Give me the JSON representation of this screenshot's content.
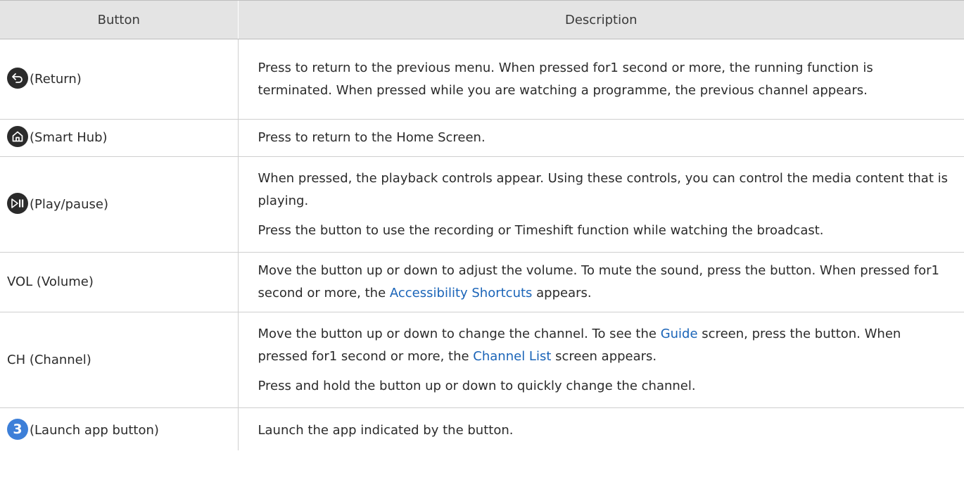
{
  "header": {
    "button": "Button",
    "description": "Description"
  },
  "rows": [
    {
      "icon": "return-icon",
      "label": "(Return)",
      "desc": [
        "Press to return to the previous menu. When pressed for1 second or more, the running function is terminated. When pressed while you are watching a programme, the previous channel appears."
      ]
    },
    {
      "icon": "home-icon",
      "label": "(Smart Hub)",
      "desc": [
        "Press to return to the Home Screen."
      ]
    },
    {
      "icon": "play-pause-icon",
      "label": "(Play/pause)",
      "desc": [
        "When pressed, the playback controls appear. Using these controls, you can control the media content that is playing.",
        "Press the button to use the recording or Timeshift function while watching the broadcast."
      ]
    },
    {
      "label": "VOL (Volume)",
      "desc_a": "Move the button up or down to adjust the volume. To mute the sound, press the button. When pressed for1 second or more, the ",
      "desc_link": "Accessibility Shortcuts",
      "desc_b": " appears."
    },
    {
      "label": "CH (Channel)",
      "desc_a": "Move the button up or down to change the channel. To see the ",
      "desc_link1": "Guide",
      "desc_b": " screen, press the button. When pressed for1 second or more, the ",
      "desc_link2": "Channel List",
      "desc_c": " screen appears.",
      "desc2": "Press and hold the button up or down to quickly change the channel."
    },
    {
      "icon": "number-3-icon",
      "icon_text": "3",
      "label": "(Launch app button)",
      "desc": [
        "Launch the app indicated by the button."
      ]
    }
  ],
  "colors": {
    "link": "#1a64b8",
    "header_bg": "#e4e4e4",
    "icon_dark": "#2b2b2b",
    "icon_blue": "#3d7fd8"
  }
}
